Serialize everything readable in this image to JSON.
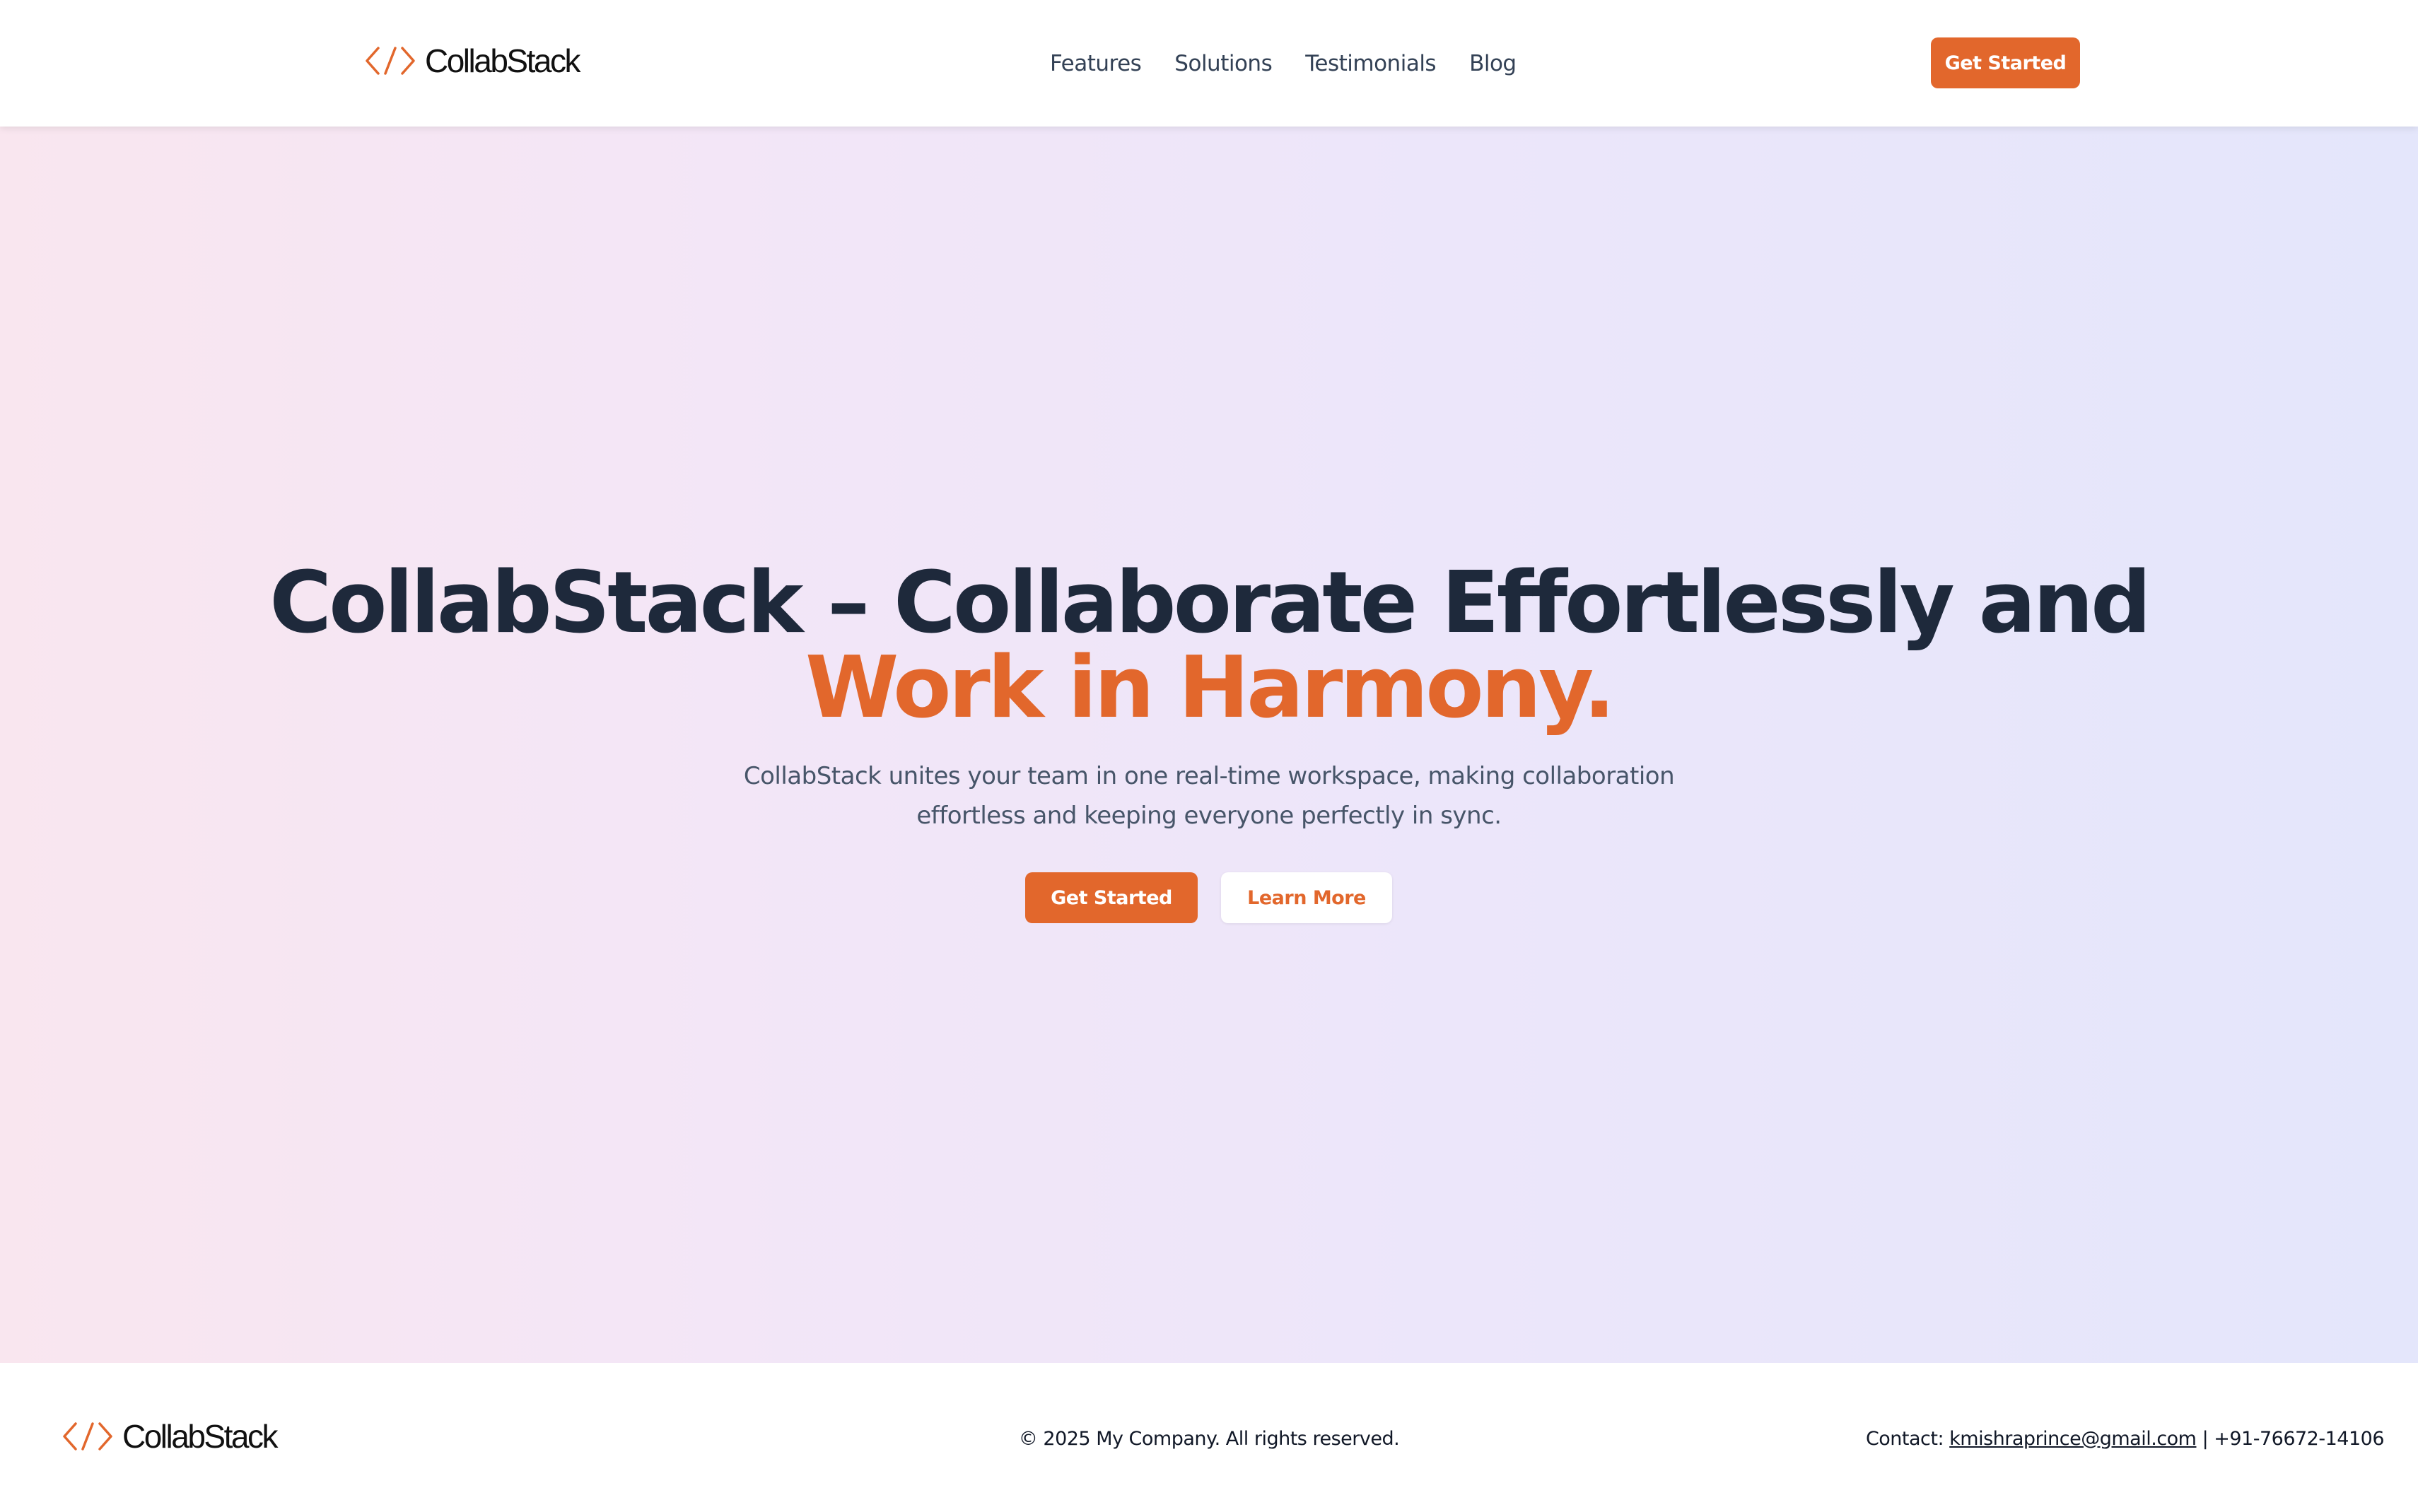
{
  "brand": {
    "name": "CollabStack",
    "logo_icon": "code-brackets-icon",
    "accent_color": "#e2672c"
  },
  "nav": {
    "items": [
      {
        "label": "Features"
      },
      {
        "label": "Solutions"
      },
      {
        "label": "Testimonials"
      },
      {
        "label": "Blog"
      }
    ],
    "cta_label": "Get Started"
  },
  "hero": {
    "title_line1": "CollabStack – Collaborate Effortlessly and",
    "title_line2": "Work in Harmony.",
    "subtitle_line1": "CollabStack unites your team in one real-time workspace, making collaboration",
    "subtitle_line2": "effortless and keeping everyone perfectly in sync.",
    "primary_cta": "Get Started",
    "secondary_cta": "Learn More"
  },
  "footer": {
    "copyright": "© 2025 My Company. All rights reserved.",
    "contact_prefix": "Contact: ",
    "email": "kmishraprince@gmail.com",
    "phone_suffix": " | +91-76672-14106"
  }
}
